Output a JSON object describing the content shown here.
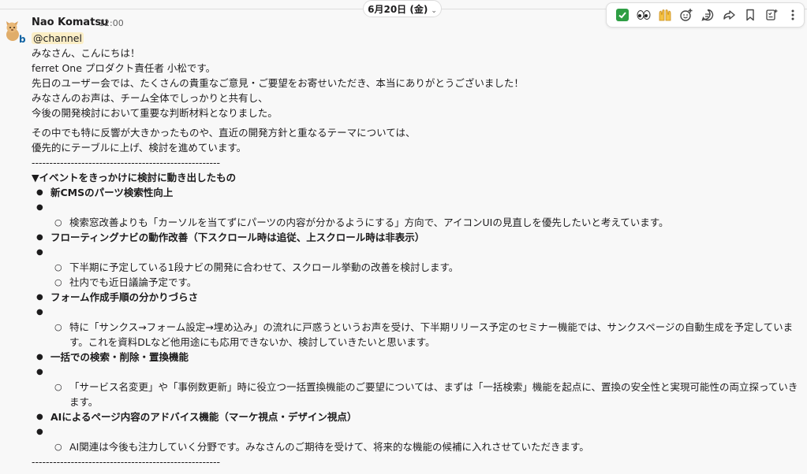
{
  "date_divider": {
    "label": "6月20日 (金)"
  },
  "toolbar": {
    "items": [
      "check-emoji",
      "eyes-emoji",
      "raised-hands-emoji",
      "add-reaction-icon",
      "reply-in-thread-icon",
      "forward-icon",
      "bookmark-icon",
      "add-to-list-icon",
      "more-actions-icon"
    ]
  },
  "message": {
    "sender": "Nao Komatsu",
    "time": "12:00",
    "avatar_badge": "b",
    "mention": "@channel",
    "intro": [
      "みなさん、こんにちは！",
      "ferret One プロダクト責任者 小松です。",
      "先日のユーザー会では、たくさんの貴重なご意見・ご要望をお寄せいただき、本当にありがとうございました！",
      "みなさんのお声は、チーム全体でしっかりと共有し、",
      "今後の開発検討において重要な判断材料となりました。"
    ],
    "intro2": [
      "その中でも特に反響が大きかったものや、直近の開発方針と重なるテーマについては、",
      "優先的にテーブルに上げ、検討を進めています。"
    ],
    "separator": "-----------------------------------------------------",
    "section_title": "▼イベントをきっかけに検討に動き出したもの",
    "items": [
      {
        "title": "新CMSのパーツ検索性向上",
        "subs": [
          "検索窓改善よりも「カーソルを当てずにパーツの内容が分かるようにする」方向で、アイコンUIの見直しを優先したいと考えています。"
        ]
      },
      {
        "title": "フローティングナビの動作改善（下スクロール時は追従、上スクロール時は非表示）",
        "subs": [
          "下半期に予定している1段ナビの開発に合わせて、スクロール挙動の改善を検討します。",
          "社内でも近日議論予定です。"
        ]
      },
      {
        "title": "フォーム作成手順の分かりづらさ",
        "subs": [
          " 特に「サンクス→フォーム設定→埋め込み」の流れに戸惑うというお声を受け、下半期リリース予定のセミナー機能では、サンクスページの自動生成を予定しています。これを資料DLなど他用途にも応用できないか、検討していきたいと思います。"
        ]
      },
      {
        "title": "一括での検索・削除・置換機能",
        "subs": [
          " 「サービス名変更」や「事例数更新」時に役立つ一括置換機能のご要望については、まずは「一括検索」機能を起点に、置換の安全性と実現可能性の両立探っていきます。"
        ]
      },
      {
        "title": "AIによるページ内容のアドバイス機能（マーケ視点・デザイン視点）",
        "subs": [
          "AI関連は今後も注力していく分野です。みなさんのご期待を受けて、将来的な機能の候補に入れさせていただきます。"
        ]
      }
    ],
    "separator_end": "-----------------------------------------------------"
  }
}
